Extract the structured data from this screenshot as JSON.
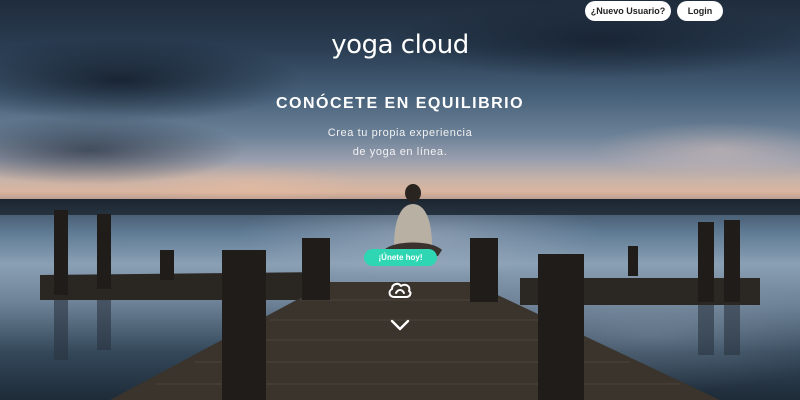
{
  "header": {
    "new_user_label": "¿Nuevo Usuario?",
    "login_label": "Login"
  },
  "brand": {
    "logo_text": "yoga cloud"
  },
  "hero": {
    "headline": "CONÓCETE EN EQUILIBRIO",
    "subline_1": "Crea tu propia experiencia",
    "subline_2": "de yoga en línea.",
    "cta_label": "¡Únete hoy!",
    "cta_color": "#2fd6b4"
  },
  "icons": {
    "logo_mark": "cloud-logo-icon",
    "scroll": "chevron-down-icon"
  }
}
